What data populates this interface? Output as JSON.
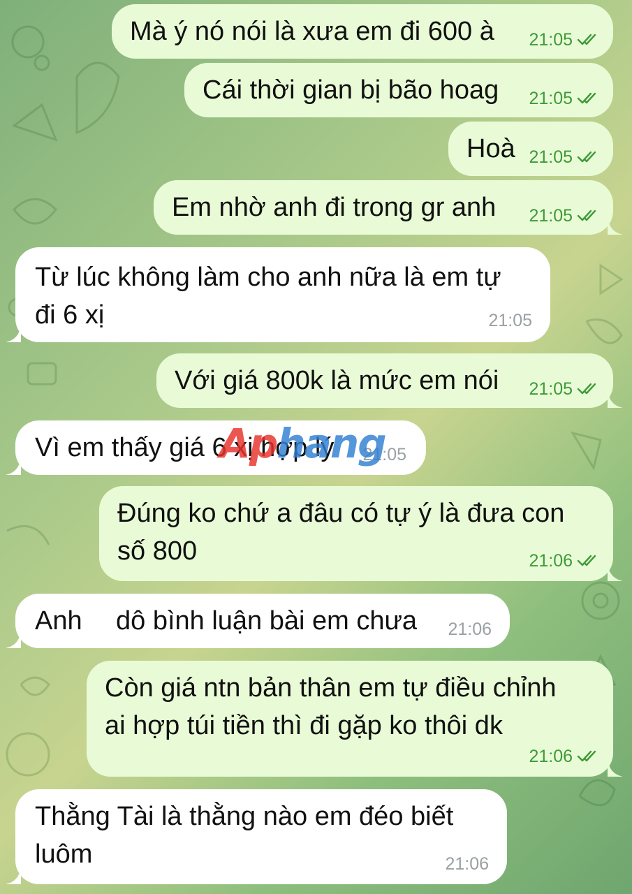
{
  "messages": [
    {
      "direction": "out",
      "text": "Mà ý nó nói là xưa em đi 600 à",
      "time": "21:05",
      "status": "read"
    },
    {
      "direction": "out",
      "text": "Cái thời gian bị bão hoag",
      "time": "21:05",
      "status": "read"
    },
    {
      "direction": "out",
      "text": "Hoà",
      "time": "21:05",
      "status": "read"
    },
    {
      "direction": "out",
      "text": "Em nhờ anh đi trong gr anh",
      "time": "21:05",
      "status": "read"
    },
    {
      "direction": "in",
      "text_lines": [
        "Từ lúc không làm cho anh nữa là em tự",
        "đi 6 xị"
      ],
      "time": "21:05"
    },
    {
      "direction": "out",
      "text": "Với giá 800k là mức em nói",
      "time": "21:05",
      "status": "read"
    },
    {
      "direction": "in",
      "text": "Vì em thấy giá 6 xị hợp lý",
      "time": "21:05"
    },
    {
      "direction": "out",
      "text_lines": [
        "Đúng ko chứ a đâu có tự ý là đưa con",
        "số 800"
      ],
      "time": "21:06",
      "status": "read"
    },
    {
      "direction": "in",
      "text_parts": [
        "Anh",
        "dô bình luận bài em chưa"
      ],
      "time": "21:06"
    },
    {
      "direction": "out",
      "text_lines": [
        "Còn giá ntn bản thân em tự điều chỉnh",
        "ai hợp túi tiền thì đi gặp ko thôi dk"
      ],
      "time": "21:06",
      "status": "read"
    },
    {
      "direction": "in",
      "text_lines": [
        "Thằng Tài là thằng nào em đéo biết",
        "luôm"
      ],
      "time": "21:06"
    }
  ],
  "watermark": {
    "part1": "Ap",
    "part2": "hang"
  },
  "colors": {
    "outgoing_bubble": "#e9fbd6",
    "incoming_bubble": "#ffffff",
    "outgoing_meta": "#3f9a39",
    "incoming_meta": "#9aa0a3",
    "watermark_red": "#e8322b",
    "watermark_blue": "#2f7fd1"
  },
  "icons": {
    "read_status": "double-check-icon"
  }
}
